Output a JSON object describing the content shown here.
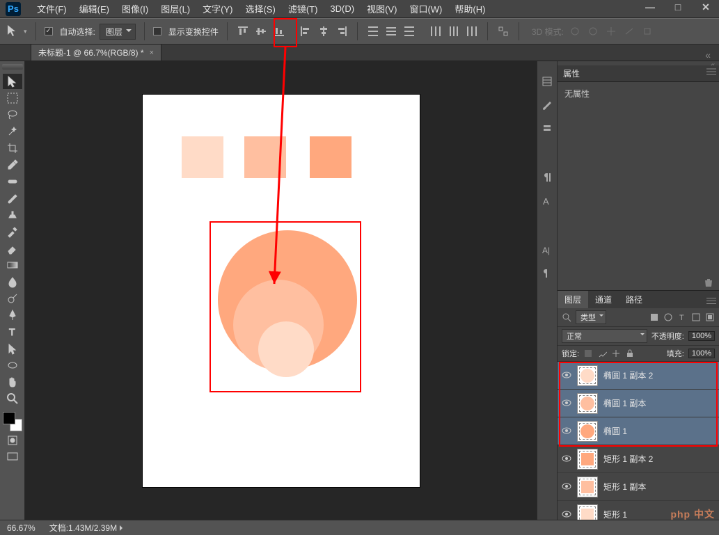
{
  "app": {
    "logo": "Ps"
  },
  "menu": {
    "file": "文件(F)",
    "edit": "编辑(E)",
    "image": "图像(I)",
    "layer": "图层(L)",
    "type": "文字(Y)",
    "select": "选择(S)",
    "filter": "滤镜(T)",
    "threeD": "3D(D)",
    "view": "视图(V)",
    "window": "窗口(W)",
    "help": "帮助(H)"
  },
  "window_controls": {
    "min": "—",
    "max": "□",
    "close": "✕"
  },
  "options": {
    "auto_select_label": "自动选择:",
    "auto_select_scope": "图层",
    "show_transform": "显示变换控件",
    "mode3d_label": "3D 模式:"
  },
  "doc_tab": {
    "title": "未标题-1 @ 66.7%(RGB/8) *",
    "close": "×"
  },
  "properties": {
    "tab": "属性",
    "empty": "无属性"
  },
  "layers_panel": {
    "tabs": {
      "layers": "图层",
      "channels": "通道",
      "paths": "路径"
    },
    "kind_label": "类型",
    "blend_mode": "正常",
    "opacity_label": "不透明度:",
    "opacity_value": "100%",
    "lock_label": "锁定:",
    "fill_label": "填充:",
    "fill_value": "100%"
  },
  "layers": [
    {
      "name": "椭圆 1 副本 2",
      "selected": true,
      "shape": "circle",
      "color": "#ffdbc7"
    },
    {
      "name": "椭圆 1 副本",
      "selected": true,
      "shape": "circle",
      "color": "#ffbfa0"
    },
    {
      "name": "椭圆 1",
      "selected": true,
      "shape": "circle",
      "color": "#ffa87e"
    },
    {
      "name": "矩形 1 副本 2",
      "selected": false,
      "shape": "square",
      "color": "#ffa87e"
    },
    {
      "name": "矩形 1 副本",
      "selected": false,
      "shape": "square",
      "color": "#ffbfa0"
    },
    {
      "name": "矩形 1",
      "selected": false,
      "shape": "square",
      "color": "#ffdbc7"
    }
  ],
  "status": {
    "zoom": "66.67%",
    "doc_info": "文档:1.43M/2.39M"
  },
  "watermark": "php 中文"
}
